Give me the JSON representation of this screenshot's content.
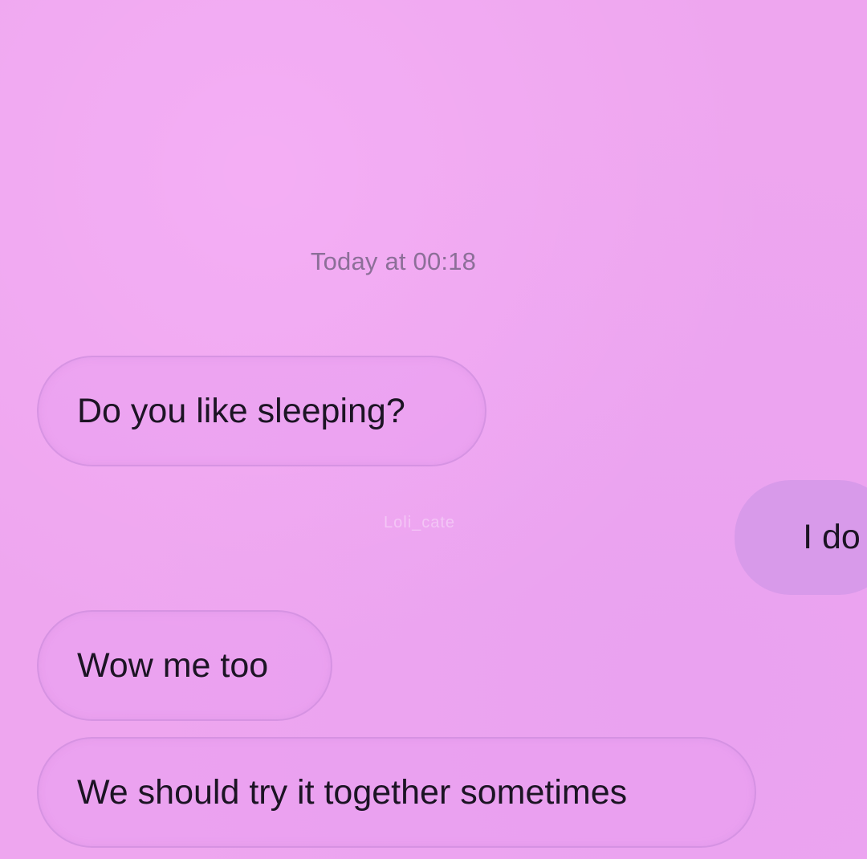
{
  "conversation": {
    "timestamp": "Today at 00:18",
    "watermark": "Loli_cate",
    "messages": [
      {
        "sender": "them",
        "text": "Do you like sleeping?"
      },
      {
        "sender": "me",
        "text": "I do"
      },
      {
        "sender": "them",
        "text": "Wow me too"
      },
      {
        "sender": "them",
        "text": "We should try it together sometimes"
      }
    ]
  },
  "colors": {
    "background": "#eea6ef",
    "received_bubble": "#e99ef0",
    "sent_bubble": "#d89aea",
    "text": "#1c1424",
    "timestamp": "#8c6f98"
  }
}
